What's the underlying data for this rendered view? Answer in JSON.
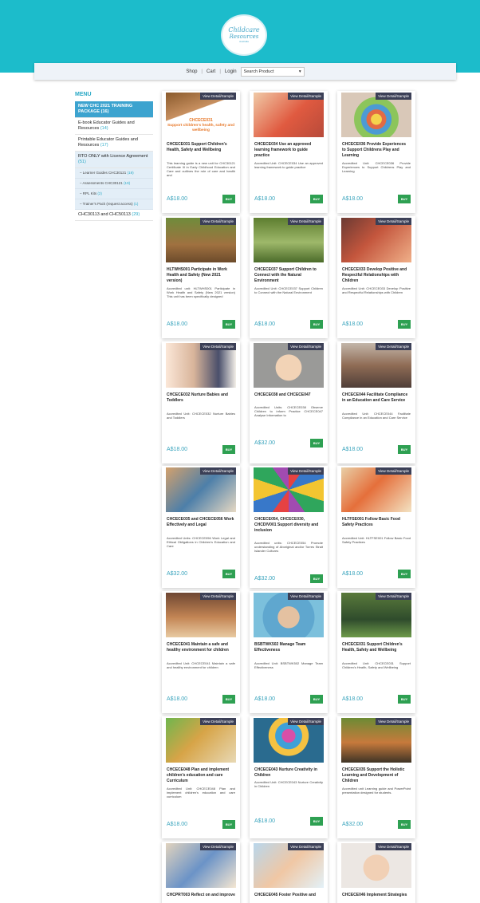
{
  "header": {
    "logo_line1": "Childcare",
    "logo_line2": "Resources",
    "logo_line3": "Australia"
  },
  "nav": {
    "shop": "Shop",
    "cart": "Cart",
    "login": "Login",
    "sep": "|",
    "search_value": "Search Product",
    "dropdown_icon": "chevron-down-icon"
  },
  "sidebar": {
    "title": "MENU",
    "items": [
      {
        "label": "NEW CHC 2021 TRAINING PACKAGE",
        "count": "(16)"
      },
      {
        "label": "E-book Educator Guides and Resources",
        "count": "(14)"
      },
      {
        "label": "Printable Educator Guides and Resources",
        "count": "(17)"
      },
      {
        "label": "RTO ONLY with Licence Agreement",
        "count": "(51)"
      },
      {
        "label": "Learner Guides CHC30121",
        "count": "(19)"
      },
      {
        "label": "Assessments CHC30121",
        "count": "(19)"
      },
      {
        "label": "RPL Kits",
        "count": "(2)"
      },
      {
        "label": "Trainer's Pack (request access)",
        "count": "(1)"
      },
      {
        "label": "CHC30113 and CHC50113",
        "count": "(29)"
      }
    ]
  },
  "view_label": "View Detail/Sample",
  "buy_label": "BUY",
  "products": [
    {
      "title": "CHCECE031 Support Children's Health, Safety and Wellbeing",
      "desc": "This learning guide is a new unit for CHC30121 Certificate III in Early Childhood Education and Care and outlines the role of care and health and",
      "price": "A$18.00",
      "img_t1": "CHCECE031",
      "img_t2": "Support children's health, safety and wellbeing"
    },
    {
      "title": "CHCECE034 Use an approved learning framework to guide practice",
      "desc": "Accredited Unit: CHCECE034 Use an approved learning framework to guide practice",
      "price": "A$18.00"
    },
    {
      "title": "CHCECE036 Provide Experiences to Support Childrens Play and Learning",
      "desc": "Accredited Unit: CHCECE036 Provide Experiences to Support Childrens Play and Learning",
      "price": "A$18.00"
    },
    {
      "title": "HLTWHS001 Participate in Work Health and Safety (New 2021 version)",
      "desc": "Accredited unit: HLTWHS001 Participate in Work Health and Safety (New 2021 version) This unit has been specifically designed",
      "price": "A$18.00"
    },
    {
      "title": "CHCECE037 Support Children to Connect with the Natural Environment",
      "desc": "Accredited Unit: CHCECE037 Support Children to Connect with the Natural Environment",
      "price": "A$18.00"
    },
    {
      "title": "CHCECE033 Develop Positive and Respectful Relationships with Children",
      "desc": "Accredited Unit: CHCECE033 Develop Positive and Respectful Relationships with Children",
      "price": "A$18.00"
    },
    {
      "title": "CHCECE032 Nurture Babies and Toddlers",
      "desc": "Accredited Unit: CHCECE032 Nurture Babies and Toddlers",
      "price": "A$18.00"
    },
    {
      "title": "CHCECE038 and CHCECE047",
      "desc": "Accredited Units: CHCECE038 Observe Children to inform Practice CHCECE047 Analyse Information to",
      "price": "A$32.00"
    },
    {
      "title": "CHCECE044 Facilitate Compliance in an Education and Care Service",
      "desc": "Accredited Unit: CHCECE044 Facilitate Compliance in an Education and Care Service",
      "price": "A$18.00"
    },
    {
      "title": "CHCECE035 and CHCECE056 Work Effectively and Legal",
      "desc": "Accredited Units: CHCECE056 Work Legal and Ethical Obligations in Children's Education and Care",
      "price": "A$32.00"
    },
    {
      "title": "CHCECE054, CHCECE030, CHCDIV001 Support diversity and inclusion",
      "desc": "Accredited units: CHCECE054 Promote understanding of Aboriginal and/or Torres Strait Islander Cultures",
      "price": "A$32.00"
    },
    {
      "title": "HLTFSE001 Follow Basic Food Safety Practices",
      "desc": "Accredited Unit: HLTFSE001 Follow Basic Food Safety Practices",
      "price": "A$18.00"
    },
    {
      "title": "CHCECE041 Maintain a safe and healthy environment for children",
      "desc": "Accredited Unit: CHCECE041 Maintain a safe and healthy environment for children",
      "price": "A$18.00"
    },
    {
      "title": "BSBTWK502 Manage Team Effectiveness",
      "desc": "Accredited Unit: BSBTWK502 Manage Team Effectiveness",
      "price": "A$18.00"
    },
    {
      "title": "CHCECE031 Support Children's Health, Safety and Wellbeing",
      "desc": "Accredited Unit: CHCECE031 Support Children's Health, Safety and Wellbeing",
      "price": "A$18.00"
    },
    {
      "title": "CHCECE048 Plan and implement children's education and care Curriculum",
      "desc": "Accredited Unit: CHCECE048 Plan and implement children's education and care curriculum",
      "price": "A$18.00"
    },
    {
      "title": "CHCECE043 Nurture Creativity in Children",
      "desc": "Accredited Unit: CHCECE043 Nurture Creativity in Children",
      "price": "A$18.00"
    },
    {
      "title": "CHCECE035 Support the Holistic Learning and Development of Children",
      "desc": "Accredited unit Learning guide and PowerPoint presentation designed for students.",
      "price": "A$32.00"
    },
    {
      "title": "CHCPRT003 Reflect on and improve",
      "desc": "",
      "price": ""
    },
    {
      "title": "CHCECE045 Foster Positive and",
      "desc": "",
      "price": ""
    },
    {
      "title": "CHCECE046 Implement Strategies",
      "desc": "",
      "price": ""
    }
  ]
}
